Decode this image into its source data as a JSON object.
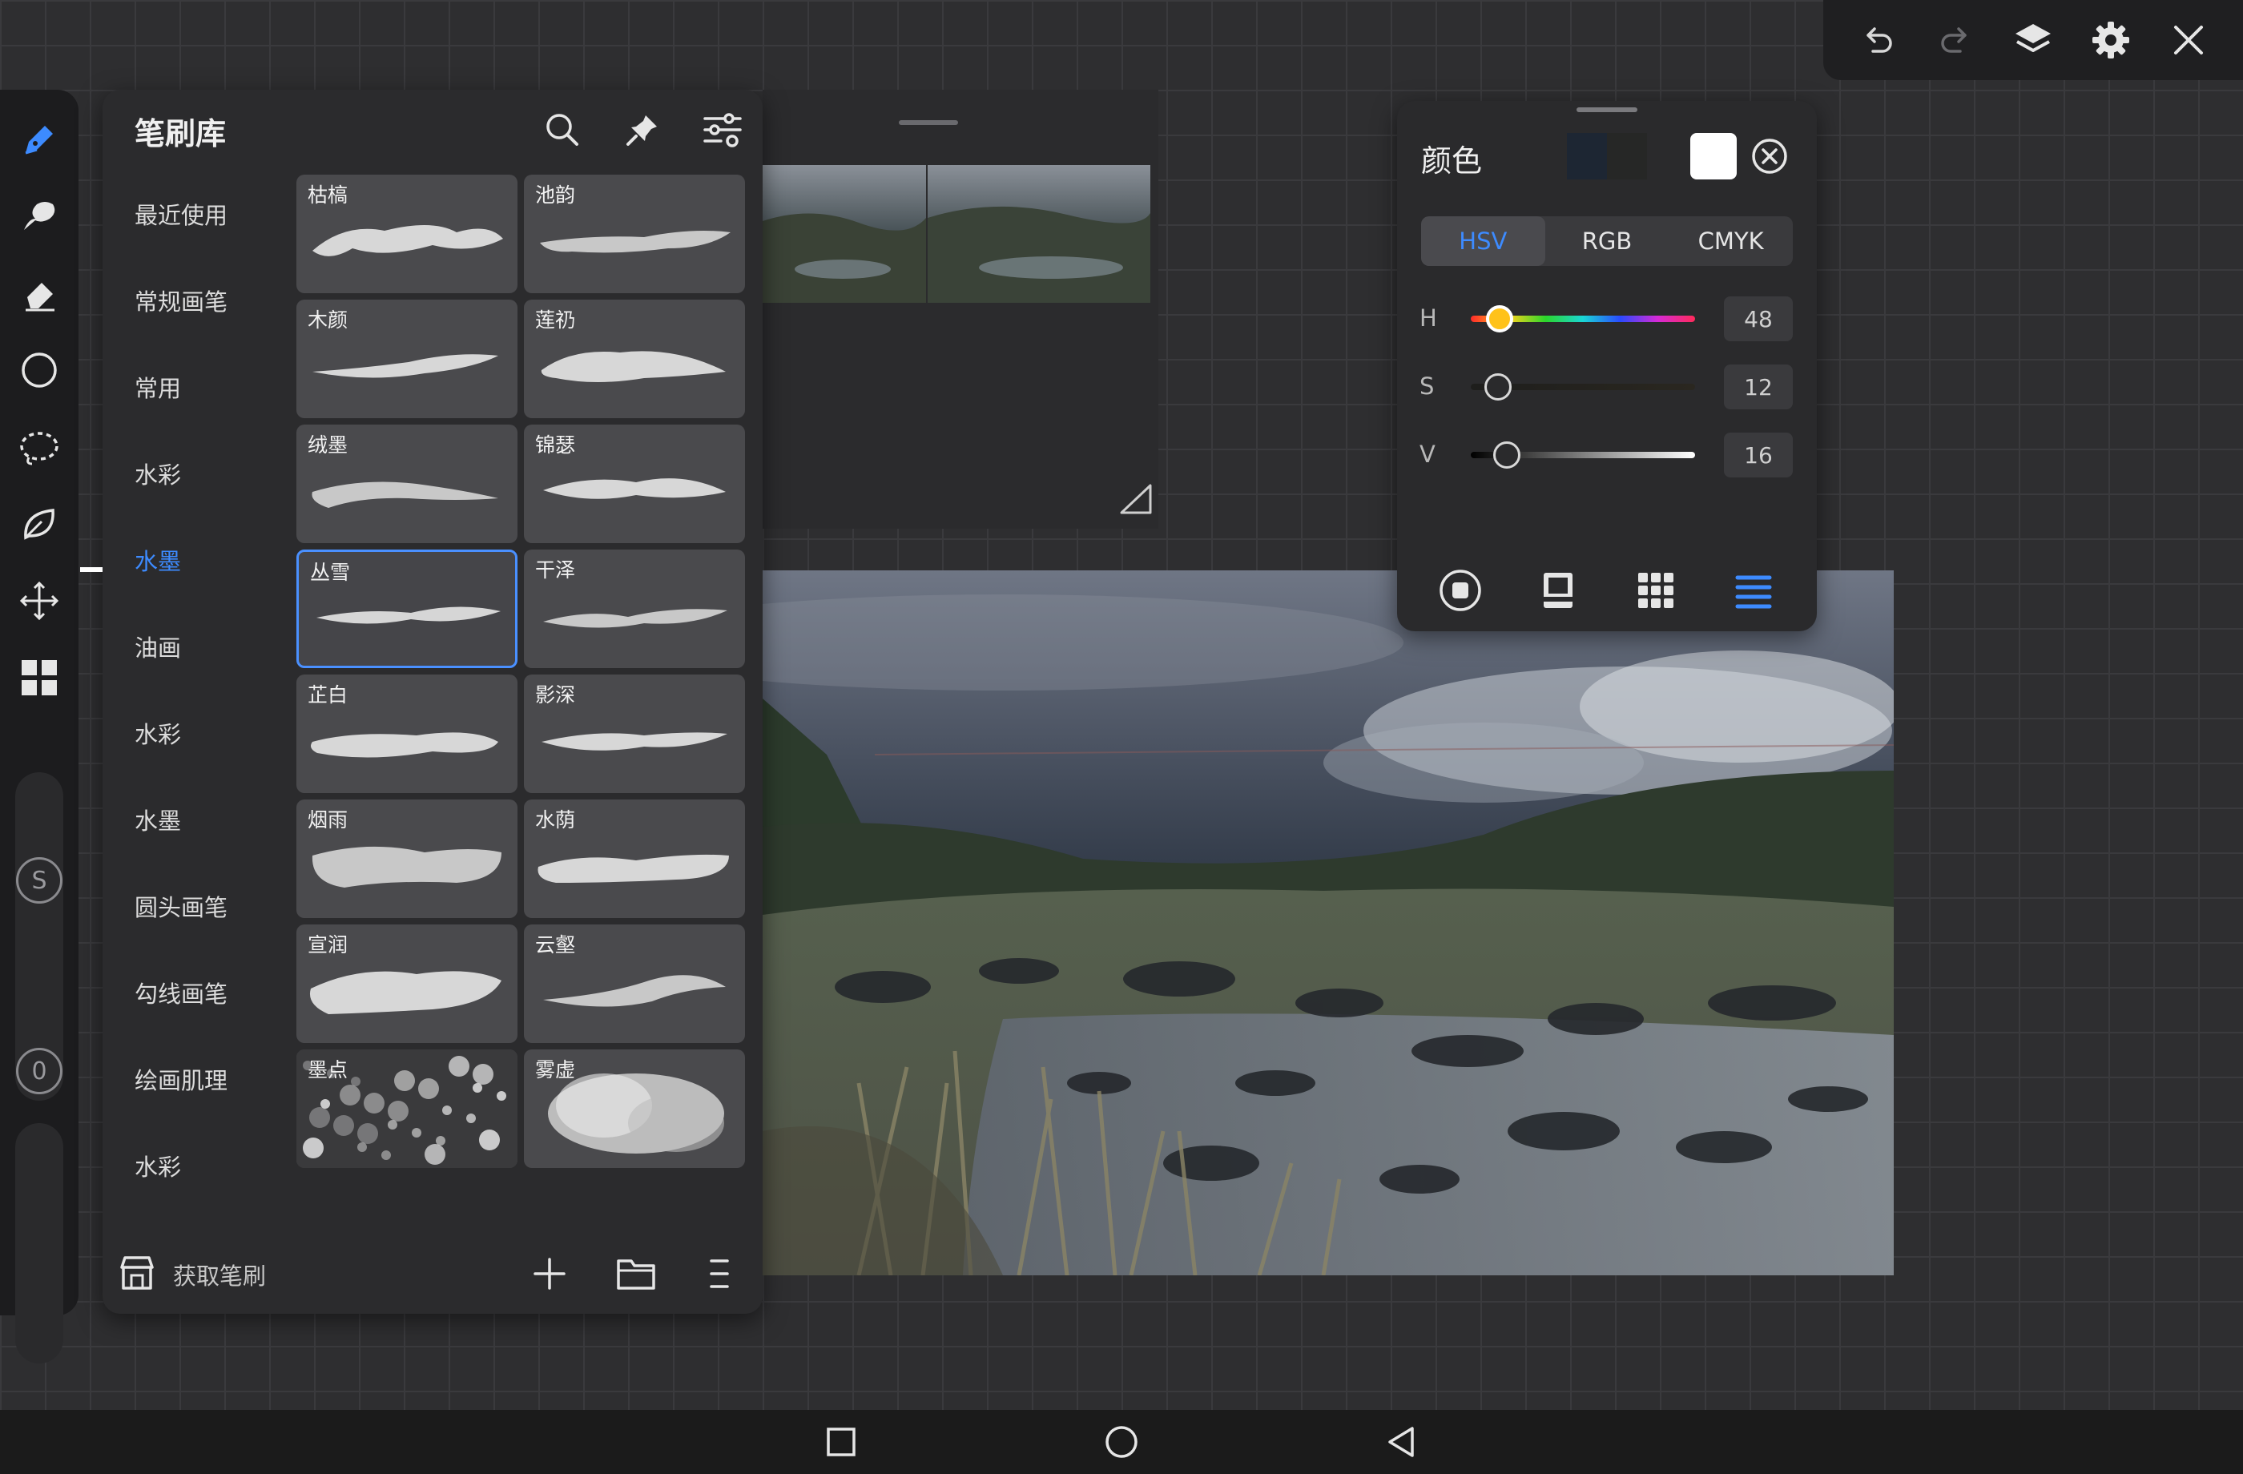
{
  "brush_library": {
    "title": "笔刷库",
    "categories": [
      "最近使用",
      "常规画笔",
      "常用",
      "水彩",
      "水墨",
      "油画",
      "水彩",
      "水墨",
      "圆头画笔",
      "勾线画笔",
      "绘画肌理",
      "水彩"
    ],
    "active_category_index": 4,
    "brushes": [
      {
        "name": "枯槁"
      },
      {
        "name": "池韵"
      },
      {
        "name": "木颜"
      },
      {
        "name": "莲礽"
      },
      {
        "name": "绒墨"
      },
      {
        "name": "锦瑟"
      },
      {
        "name": "丛雪"
      },
      {
        "name": "干泽"
      },
      {
        "name": "芷白"
      },
      {
        "name": "影深"
      },
      {
        "name": "烟雨"
      },
      {
        "name": "水荫"
      },
      {
        "name": "宣润"
      },
      {
        "name": "云壑"
      },
      {
        "name": "墨点"
      },
      {
        "name": "雾虚"
      }
    ],
    "selected_brush_index": 6,
    "footer": {
      "get_brushes": "获取笔刷"
    }
  },
  "rail": {
    "size_badge": "S",
    "opacity_badge": "0"
  },
  "color_panel": {
    "title": "颜色",
    "modes": [
      "HSV",
      "RGB",
      "CMYK"
    ],
    "active_mode": "HSV",
    "current_color": "#ffffff",
    "previous_color": "#1d2633",
    "sliders": [
      {
        "label": "H",
        "value": "48",
        "position": 0.13
      },
      {
        "label": "S",
        "value": "12",
        "position": 0.12
      },
      {
        "label": "V",
        "value": "16",
        "position": 0.16
      }
    ]
  },
  "colors": {
    "accent": "#3d8bff",
    "panel": "#2a2a2c",
    "background": "#2e2e30"
  }
}
